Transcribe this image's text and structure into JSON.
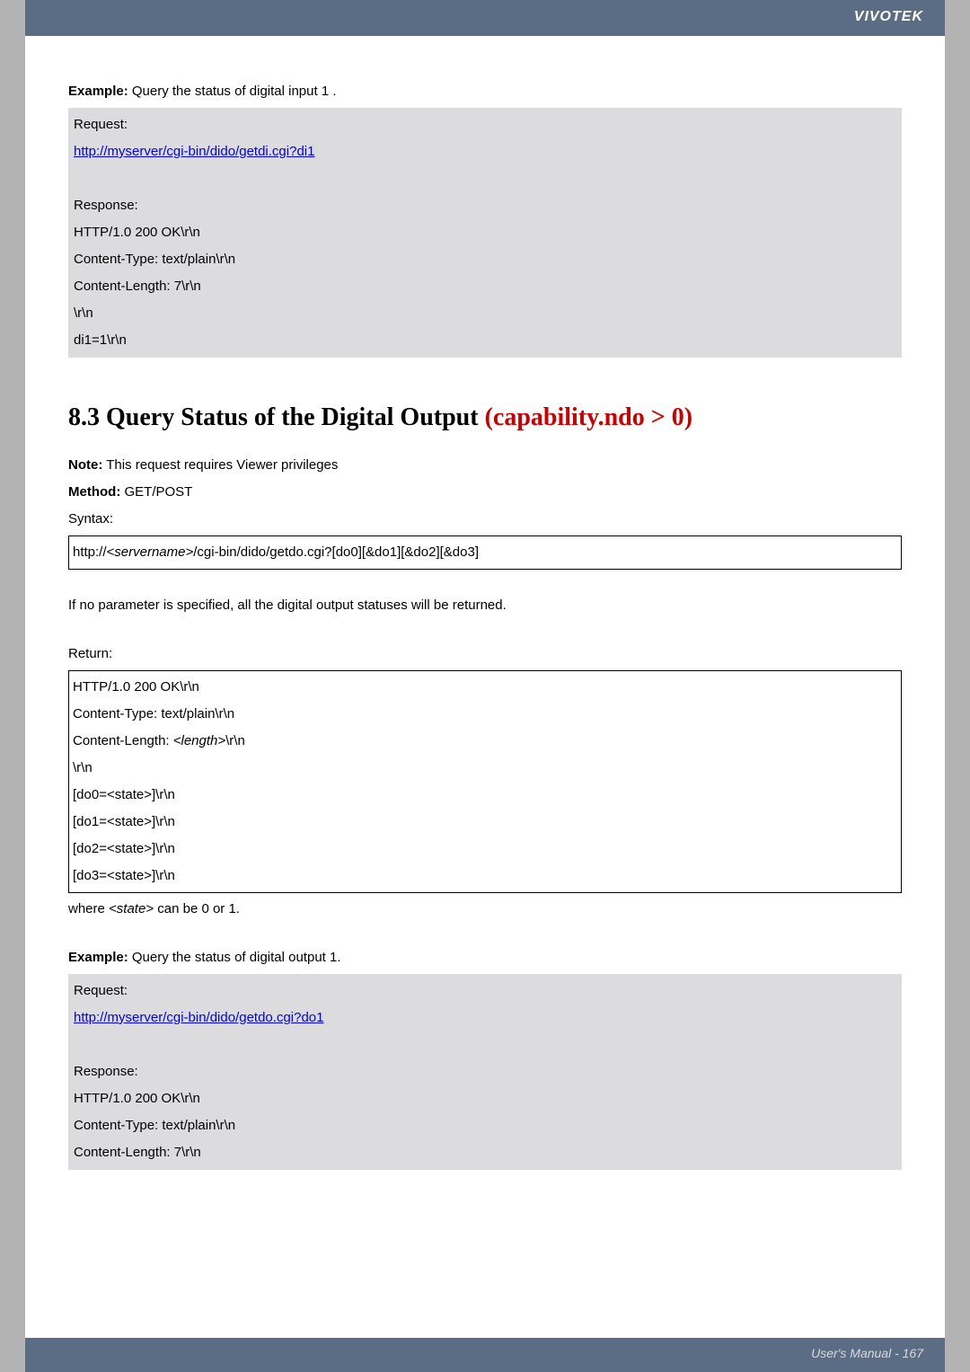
{
  "brand": "VIVOTEK",
  "example1": {
    "label": "Example:",
    "text": " Query the status of digital input 1 .",
    "request_label": "Request:",
    "request_url": "http://myserver/cgi-bin/dido/getdi.cgi?di1",
    "response_label": "Response:",
    "response_lines": [
      "HTTP/1.0 200 OK\\r\\n",
      "Content-Type: text/plain\\r\\n",
      "Content-Length: 7\\r\\n",
      "\\r\\n",
      "di1=1\\r\\n"
    ]
  },
  "section": {
    "number": "8.3 Query Status of the Digital Output ",
    "red_part": "(capability.ndo > 0)"
  },
  "note": {
    "label": "Note:",
    "text": " This request requires Viewer privileges"
  },
  "method": {
    "label": "Method:",
    "text": " GET/POST"
  },
  "syntax_label": "Syntax:",
  "syntax_box": {
    "prefix": "http://",
    "servername": "<servername>",
    "suffix": "/cgi-bin/dido/getdo.cgi?[do0][&do1][&do2][&do3]"
  },
  "no_param_text": "If no parameter is specified, all the digital output statuses will be returned.",
  "return_label": "Return:",
  "return_box": {
    "lines": [
      "HTTP/1.0 200 OK\\r\\n",
      "Content-Type: text/plain\\r\\n"
    ],
    "length_prefix": "Content-Length: ",
    "length_italic": "<length>",
    "length_suffix": "\\r\\n",
    "rn": "\\r\\n",
    "do_lines": [
      "[do0=<state>]\\r\\n",
      "[do1=<state>]\\r\\n",
      "[do2=<state>]\\r\\n",
      "[do3=<state>]\\r\\n"
    ]
  },
  "where_line": {
    "prefix": "where ",
    "state": "<state>",
    "suffix": " can be 0 or 1."
  },
  "example2": {
    "label": "Example:",
    "text": " Query the status of digital output 1.",
    "request_label": "Request:",
    "request_url": "http://myserver/cgi-bin/dido/getdo.cgi?do1",
    "response_label": "Response:",
    "response_lines": [
      "HTTP/1.0 200 OK\\r\\n",
      "Content-Type: text/plain\\r\\n",
      "Content-Length: 7\\r\\n"
    ]
  },
  "footer": "User's Manual - 167"
}
